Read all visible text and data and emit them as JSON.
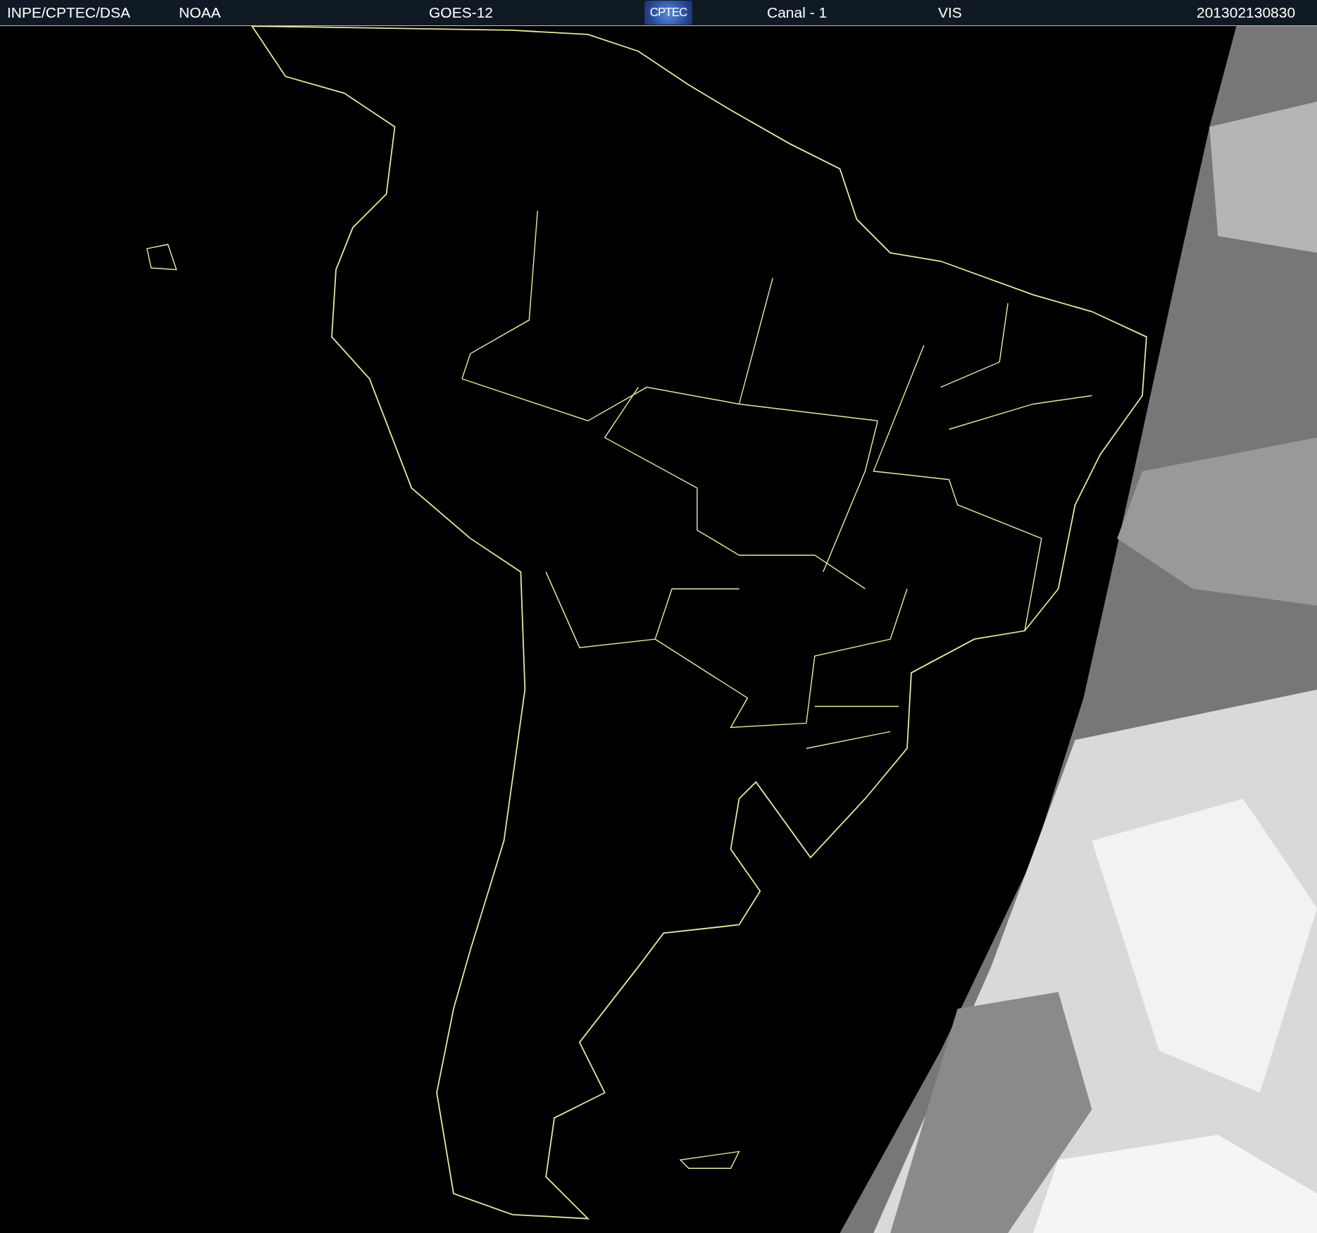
{
  "header": {
    "items": [
      {
        "kind": "text",
        "text": "INPE/CPTEC/DSA"
      },
      {
        "kind": "text",
        "text": "NOAA"
      },
      {
        "kind": "text",
        "text": "GOES-12"
      },
      {
        "kind": "logo",
        "text": "CPTEC"
      },
      {
        "kind": "text",
        "text": "Canal - 1"
      },
      {
        "kind": "text",
        "text": "VIS"
      },
      {
        "kind": "text",
        "text": "201302130830"
      }
    ]
  }
}
